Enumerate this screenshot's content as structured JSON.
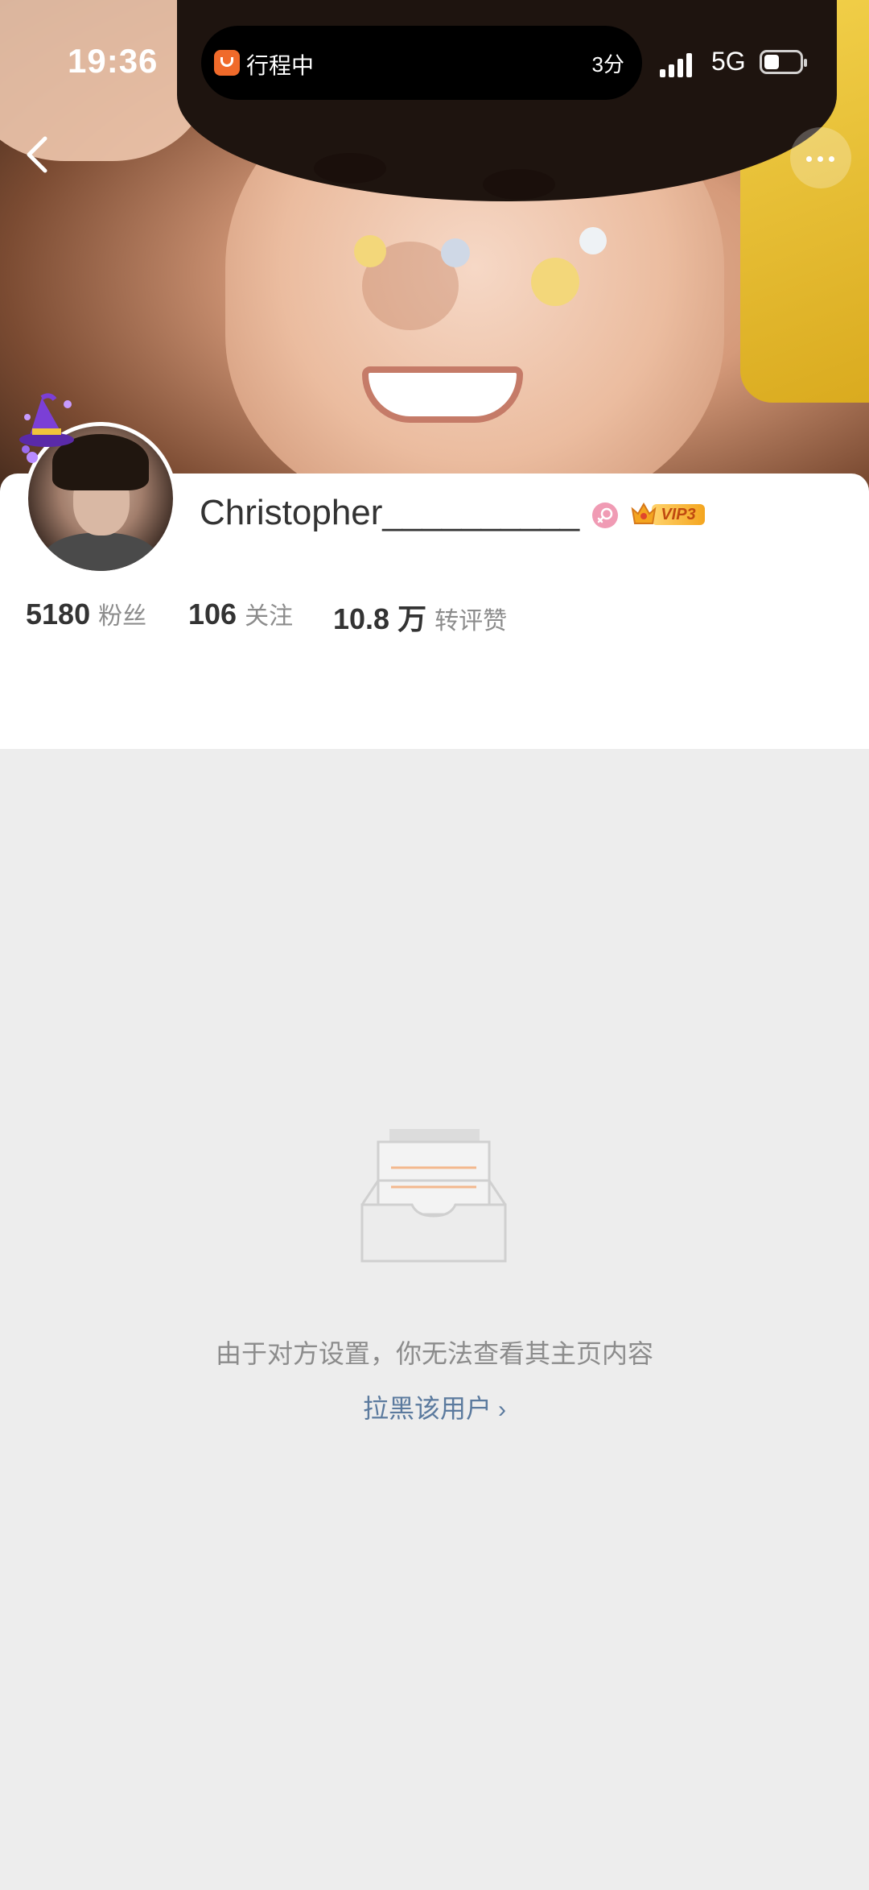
{
  "status_bar": {
    "time": "19:36",
    "island_title": "行程中",
    "island_right": "3分",
    "network": "5G"
  },
  "profile": {
    "username": "Christopher__________",
    "vip_label": "VIP3",
    "stats": [
      {
        "value": "5180",
        "label": "粉丝"
      },
      {
        "value": "106",
        "label": "关注"
      },
      {
        "value": "10.8 万",
        "label": "转评赞"
      }
    ]
  },
  "empty_state": {
    "message": "由于对方设置，你无法查看其主页内容",
    "block_link": "拉黑该用户"
  },
  "colors": {
    "link": "#5b7a9e",
    "background": "#ededed",
    "vip_gold": "#f4a51f",
    "gender_pink": "#f09bb4"
  },
  "icons": [
    "back-arrow-icon",
    "more-dots-icon",
    "female-gender-icon",
    "vip-crown-icon",
    "witch-hat-icon",
    "empty-inbox-icon",
    "chevron-right-icon"
  ]
}
